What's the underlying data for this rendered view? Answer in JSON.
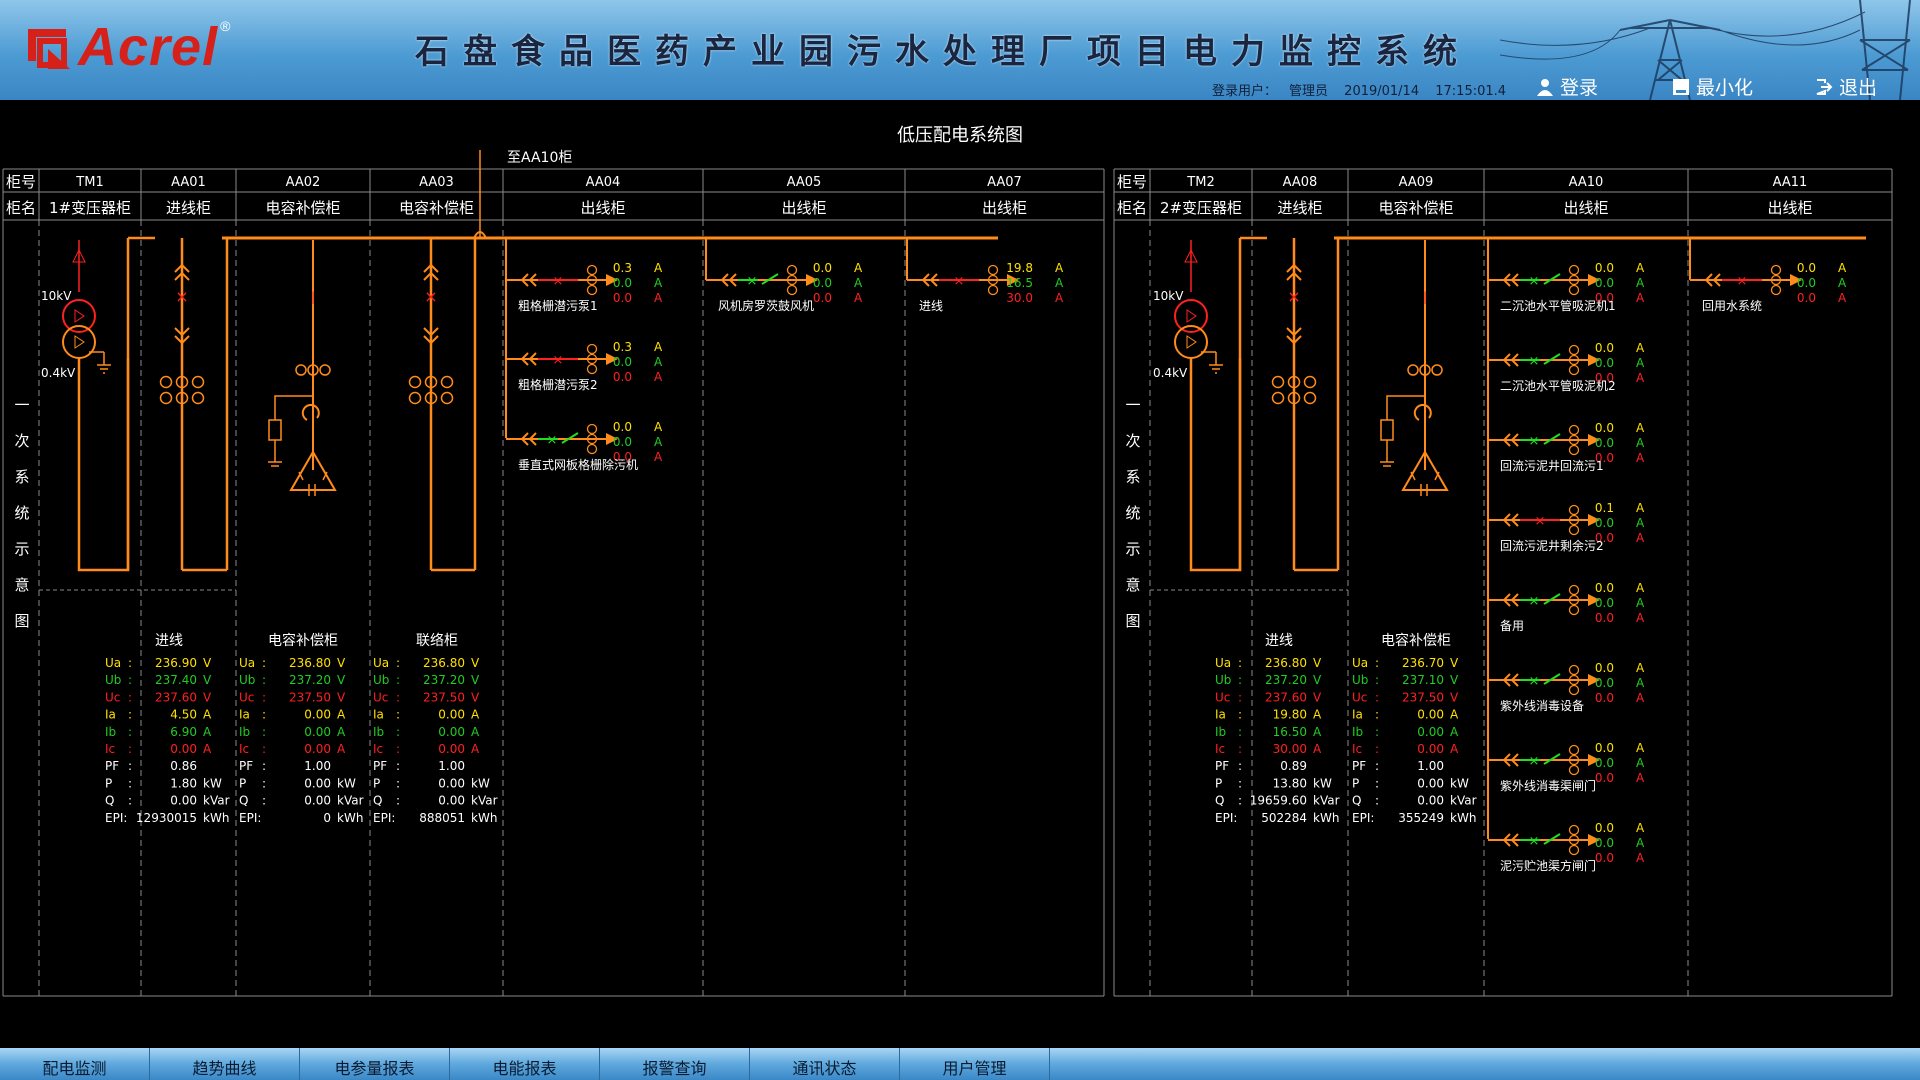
{
  "header": {
    "logo_text": "Acrel",
    "logo_reg": "®",
    "title": "石盘食品医药产业园污水处理厂项目电力监控系统",
    "login_label": "登录用户：",
    "user": "管理员",
    "date": "2019/01/14",
    "time": "17:15:01.4",
    "btn_login": "登录",
    "btn_minimize": "最小化",
    "btn_exit": "退出"
  },
  "diagram_title": "低压配电系统图",
  "row_labels": {
    "id": "柜号",
    "name": "柜名"
  },
  "side_label": [
    "一",
    "次",
    "系",
    "统",
    "示",
    "意",
    "图"
  ],
  "bus_tie_note": "至AA10柜",
  "panels": {
    "left": {
      "cabinets": [
        {
          "id": "TM1",
          "name": "1#变压器柜"
        },
        {
          "id": "AA01",
          "name": "进线柜"
        },
        {
          "id": "AA02",
          "name": "电容补偿柜"
        },
        {
          "id": "AA03",
          "name": "电容补偿柜"
        },
        {
          "id": "AA04",
          "name": "出线柜"
        },
        {
          "id": "AA05",
          "name": "出线柜"
        },
        {
          "id": "AA07",
          "name": "出线柜"
        }
      ],
      "voltage_hi": "10kV",
      "voltage_lo": "0.4kV",
      "feeders": [
        {
          "name": "粗格栅潜污泵1",
          "a": "0.3",
          "b": "0.0",
          "c": "0.0",
          "state": "off"
        },
        {
          "name": "粗格栅潜污泵2",
          "a": "0.3",
          "b": "0.0",
          "c": "0.0",
          "state": "off"
        },
        {
          "name": "垂直式网板格栅除污机",
          "a": "0.0",
          "b": "0.0",
          "c": "0.0",
          "state": "on"
        },
        {
          "name": "风机房罗茨鼓风机",
          "a": "0.0",
          "b": "0.0",
          "c": "0.0",
          "state": "on"
        },
        {
          "name": "进线",
          "a": "19.8",
          "b": "16.5",
          "c": "30.0",
          "state": "off"
        }
      ],
      "meters": [
        {
          "title": "进线",
          "Ua": "236.90",
          "Ub": "237.40",
          "Uc": "237.60",
          "Ia": "4.50",
          "Ib": "6.90",
          "Ic": "0.00",
          "PF": "0.86",
          "P": "1.80",
          "Q": "0.00",
          "EPI": "12930015"
        },
        {
          "title": "电容补偿柜",
          "Ua": "236.80",
          "Ub": "237.20",
          "Uc": "237.50",
          "Ia": "0.00",
          "Ib": "0.00",
          "Ic": "0.00",
          "PF": "1.00",
          "P": "0.00",
          "Q": "0.00",
          "EPI": "0"
        },
        {
          "title": "联络柜",
          "Ua": "236.80",
          "Ub": "237.20",
          "Uc": "237.50",
          "Ia": "0.00",
          "Ib": "0.00",
          "Ic": "0.00",
          "PF": "1.00",
          "P": "0.00",
          "Q": "0.00",
          "EPI": "888051"
        }
      ]
    },
    "right": {
      "cabinets": [
        {
          "id": "TM2",
          "name": "2#变压器柜"
        },
        {
          "id": "AA08",
          "name": "进线柜"
        },
        {
          "id": "AA09",
          "name": "电容补偿柜"
        },
        {
          "id": "AA10",
          "name": "出线柜"
        },
        {
          "id": "AA11",
          "name": "出线柜"
        }
      ],
      "voltage_hi": "10kV",
      "voltage_lo": "0.4kV",
      "feeders": [
        {
          "name": "二沉池水平管吸泥机1",
          "a": "0.0",
          "b": "0.0",
          "c": "0.0",
          "state": "on"
        },
        {
          "name": "二沉池水平管吸泥机2",
          "a": "0.0",
          "b": "0.0",
          "c": "0.0",
          "state": "on"
        },
        {
          "name": "回流污泥井回流污1",
          "a": "0.0",
          "b": "0.0",
          "c": "0.0",
          "state": "on"
        },
        {
          "name": "回流污泥井剩余污2",
          "a": "0.1",
          "b": "0.0",
          "c": "0.0",
          "state": "off"
        },
        {
          "name": "备用",
          "a": "0.0",
          "b": "0.0",
          "c": "0.0",
          "state": "on"
        },
        {
          "name": "紫外线消毒设备",
          "a": "0.0",
          "b": "0.0",
          "c": "0.0",
          "state": "on"
        },
        {
          "name": "紫外线消毒渠闸门",
          "a": "0.0",
          "b": "0.0",
          "c": "0.0",
          "state": "on"
        },
        {
          "name": "泥污贮池渠方闸门",
          "a": "0.0",
          "b": "0.0",
          "c": "0.0",
          "state": "on"
        },
        {
          "name": "回用水系统",
          "a": "0.0",
          "b": "0.0",
          "c": "0.0",
          "state": "off"
        }
      ],
      "meters": [
        {
          "title": "进线",
          "Ua": "236.80",
          "Ub": "237.20",
          "Uc": "237.60",
          "Ia": "19.80",
          "Ib": "16.50",
          "Ic": "30.00",
          "PF": "0.89",
          "P": "13.80",
          "Q": "19659.60",
          "EPI": "502284"
        },
        {
          "title": "电容补偿柜",
          "Ua": "236.70",
          "Ub": "237.10",
          "Uc": "237.50",
          "Ia": "0.00",
          "Ib": "0.00",
          "Ic": "0.00",
          "PF": "1.00",
          "P": "0.00",
          "Q": "0.00",
          "EPI": "355249"
        }
      ]
    }
  },
  "units": {
    "V": "V",
    "A": "A",
    "kW": "kW",
    "kVar": "kVar",
    "kWh": "kWh"
  },
  "colors": {
    "bus": "#ff8c1a",
    "closed": "#ff2020",
    "open": "#22dd22",
    "phase_a": "#ffe000",
    "phase_b": "#22cc22",
    "phase_c": "#ff2020",
    "grid": "#8a8a8a"
  },
  "nav": [
    "配电监测",
    "趋势曲线",
    "电参量报表",
    "电能报表",
    "报警查询",
    "通讯状态",
    "用户管理"
  ]
}
